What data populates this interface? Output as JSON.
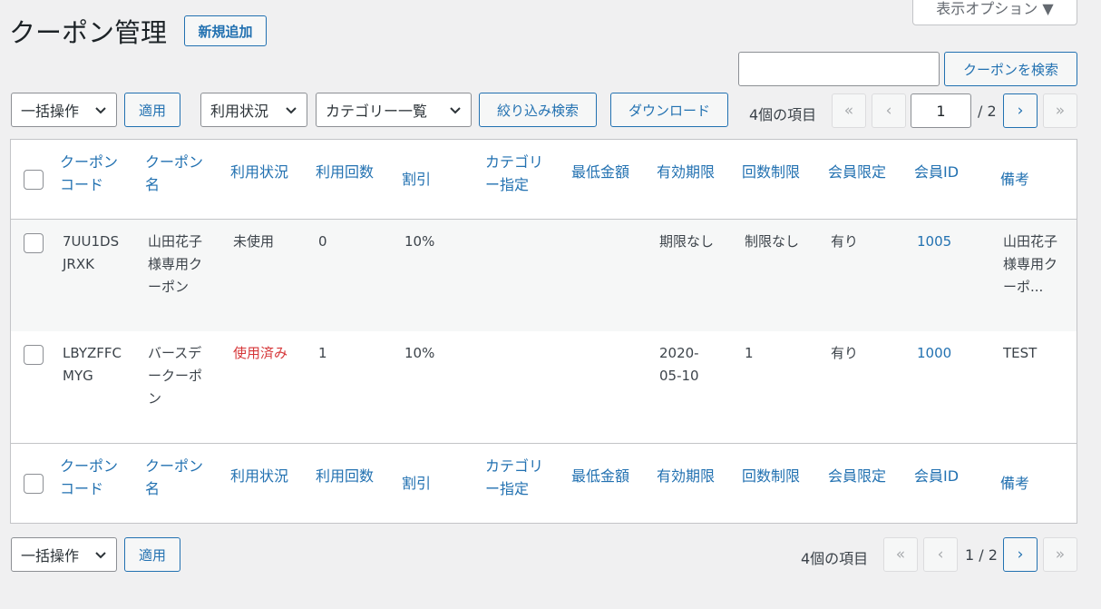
{
  "page": {
    "title": "クーポン管理",
    "add_new": "新規追加",
    "screen_options": "表示オプション ▼"
  },
  "search": {
    "value": "",
    "button": "クーポンを検索"
  },
  "top_nav": {
    "bulk_action": "一括操作",
    "apply": "適用",
    "usage_filter": "利用状況",
    "category_filter": "カテゴリー一覧",
    "filter_button": "絞り込み検索",
    "download": "ダウンロード",
    "item_count": "4個の項目",
    "first": "«",
    "prev": "‹",
    "current_page": "1",
    "total_pages": "/ 2",
    "next": "›",
    "last": "»"
  },
  "bottom_nav": {
    "bulk_action": "一括操作",
    "apply": "適用",
    "item_count": "4個の項目",
    "first": "«",
    "prev": "‹",
    "page_info": "1 / 2",
    "next": "›",
    "last": "»"
  },
  "columns": [
    {
      "l1": "クーポン",
      "l2": "コード"
    },
    {
      "l1": "クーポン",
      "l2": "名"
    },
    {
      "l1": "利用状況",
      "l2": ""
    },
    {
      "l1": "利用回数",
      "l2": ""
    },
    {
      "l1": "割引",
      "l2": ""
    },
    {
      "l1": "カテゴリ",
      "l2": "ー指定"
    },
    {
      "l1": "最低金額",
      "l2": ""
    },
    {
      "l1": "有効期限",
      "l2": ""
    },
    {
      "l1": "回数制限",
      "l2": ""
    },
    {
      "l1": "会員限定",
      "l2": ""
    },
    {
      "l1": "会員ID",
      "l2": ""
    },
    {
      "l1": "備考",
      "l2": ""
    }
  ],
  "rows": [
    {
      "code": [
        "7UU1DS",
        "JRXK"
      ],
      "name": [
        "山田花子",
        "様専用ク",
        "ーポン"
      ],
      "status": "未使用",
      "uses": "0",
      "discount": "10%",
      "category": "",
      "min_amount": "",
      "expiry": [
        "期限なし"
      ],
      "limit": "制限なし",
      "member_only": "有り",
      "member_id": "1005",
      "note": [
        "山田花子",
        "様専用ク",
        "ーポ..."
      ]
    },
    {
      "code": [
        "LBYZFFC",
        "MYG"
      ],
      "name": [
        "バースデ",
        "ークーポ",
        "ン"
      ],
      "status": "使用済み",
      "uses": "1",
      "discount": "10%",
      "category": "",
      "min_amount": "",
      "expiry": [
        "2020-",
        "05-10"
      ],
      "limit": "1",
      "member_only": "有り",
      "member_id": "1000",
      "note": [
        "TEST"
      ]
    }
  ],
  "colors": {
    "link": "#2271b1",
    "used_status": "#d63638",
    "background": "#f0f0f1"
  }
}
